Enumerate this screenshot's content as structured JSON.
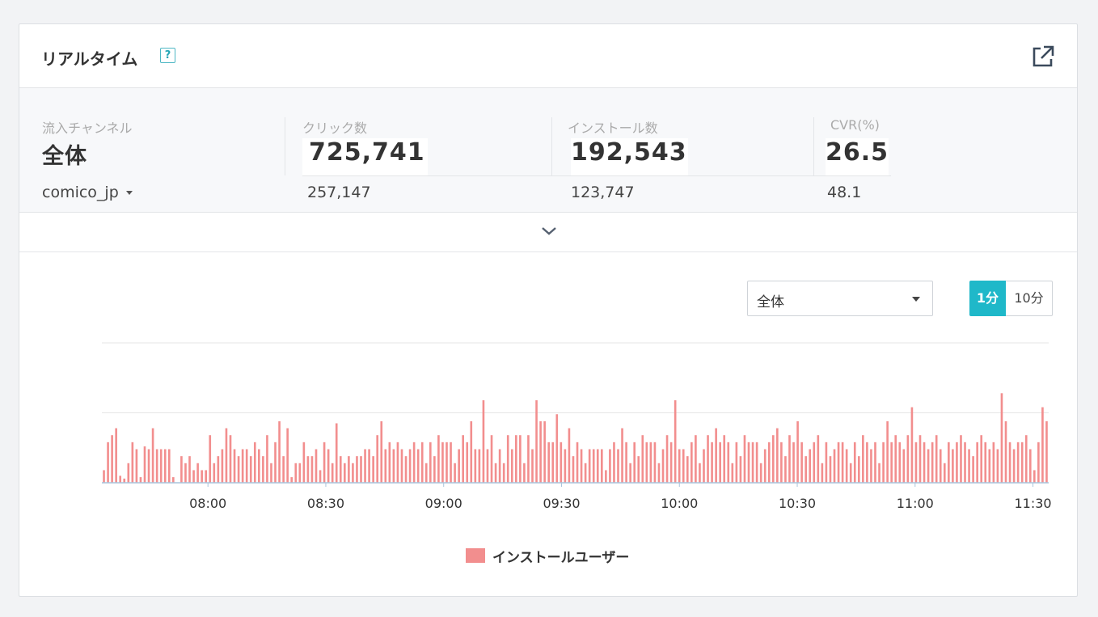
{
  "header": {
    "title": "リアルタイム",
    "help_label": "?",
    "external_link_icon": "external-link-icon"
  },
  "stats": {
    "channel": {
      "label": "流入チャンネル",
      "value": "全体",
      "sub": "comico_jp"
    },
    "clicks": {
      "label": "クリック数",
      "value": "725,741",
      "sub": "257,147"
    },
    "installs": {
      "label": "インストール数",
      "value": "192,543",
      "sub": "123,747"
    },
    "cvr": {
      "label": "CVR(%)",
      "value": "26.5",
      "sub": "48.1"
    }
  },
  "expand_icon": "chevron-down-icon",
  "filter": {
    "selected": "全体"
  },
  "interval": {
    "options": [
      "1分",
      "10分"
    ],
    "selected": "1分"
  },
  "colors": {
    "accent": "#1fb8c9",
    "bar": "#f28e8e",
    "axis": "#a9c4dc",
    "grid": "#e6e6e6"
  },
  "chart_data": {
    "type": "bar",
    "x_start_minute": 453,
    "x_end_minute": 694,
    "x_tick_labels": [
      "08:00",
      "08:30",
      "09:00",
      "09:30",
      "10:00",
      "10:30",
      "11:00",
      "11:30"
    ],
    "ylim": [
      0,
      2
    ],
    "grid": true,
    "legend": "bottom",
    "series": [
      {
        "name": "インストールユーザー",
        "values": [
          0.18,
          0.58,
          0.68,
          0.78,
          0.1,
          0.06,
          0.28,
          0.58,
          0.48,
          0.08,
          0.52,
          0.48,
          0.78,
          0.48,
          0.48,
          0.48,
          0.48,
          0.08,
          0.0,
          0.38,
          0.28,
          0.38,
          0.18,
          0.28,
          0.18,
          0.18,
          0.68,
          0.28,
          0.38,
          0.48,
          0.78,
          0.68,
          0.48,
          0.38,
          0.48,
          0.48,
          0.38,
          0.58,
          0.48,
          0.38,
          0.68,
          0.28,
          0.58,
          0.88,
          0.38,
          0.78,
          0.08,
          0.28,
          0.28,
          0.58,
          0.38,
          0.38,
          0.48,
          0.18,
          0.58,
          0.48,
          0.28,
          0.85,
          0.38,
          0.28,
          0.38,
          0.28,
          0.38,
          0.38,
          0.48,
          0.48,
          0.38,
          0.68,
          0.88,
          0.48,
          0.58,
          0.48,
          0.58,
          0.48,
          0.38,
          0.48,
          0.58,
          0.48,
          0.58,
          0.28,
          0.58,
          0.38,
          0.68,
          0.58,
          0.58,
          0.58,
          0.28,
          0.48,
          0.68,
          0.58,
          0.88,
          0.48,
          0.48,
          1.18,
          0.48,
          0.68,
          0.28,
          0.48,
          0.28,
          0.68,
          0.48,
          0.68,
          0.68,
          0.28,
          0.68,
          0.48,
          1.18,
          0.88,
          0.88,
          0.58,
          0.58,
          0.98,
          0.58,
          0.48,
          0.78,
          0.38,
          0.58,
          0.48,
          0.28,
          0.48,
          0.48,
          0.48,
          0.48,
          0.18,
          0.48,
          0.58,
          0.48,
          0.78,
          0.58,
          0.28,
          0.58,
          0.38,
          0.68,
          0.58,
          0.58,
          0.58,
          0.28,
          0.48,
          0.68,
          0.58,
          1.18,
          0.48,
          0.48,
          0.38,
          0.58,
          0.68,
          0.28,
          0.48,
          0.68,
          0.58,
          0.78,
          0.58,
          0.68,
          0.58,
          0.28,
          0.58,
          0.38,
          0.68,
          0.58,
          0.58,
          0.58,
          0.28,
          0.48,
          0.58,
          0.68,
          0.78,
          0.58,
          0.38,
          0.68,
          0.58,
          0.88,
          0.58,
          0.38,
          0.48,
          0.58,
          0.68,
          0.28,
          0.58,
          0.38,
          0.48,
          0.58,
          0.58,
          0.48,
          0.28,
          0.58,
          0.38,
          0.68,
          0.58,
          0.48,
          0.58,
          0.28,
          0.58,
          0.88,
          0.58,
          0.68,
          0.58,
          0.48,
          0.68,
          1.08,
          0.58,
          0.68,
          0.58,
          0.48,
          0.58,
          0.68,
          0.48,
          0.28,
          0.58,
          0.48,
          0.58,
          0.68,
          0.58,
          0.48,
          0.38,
          0.58,
          0.68,
          0.58,
          0.48,
          0.58,
          0.48,
          1.28,
          0.88,
          0.58,
          0.48,
          0.58,
          0.58,
          0.68,
          0.48,
          0.18,
          0.58,
          1.08,
          0.88
        ]
      }
    ]
  }
}
